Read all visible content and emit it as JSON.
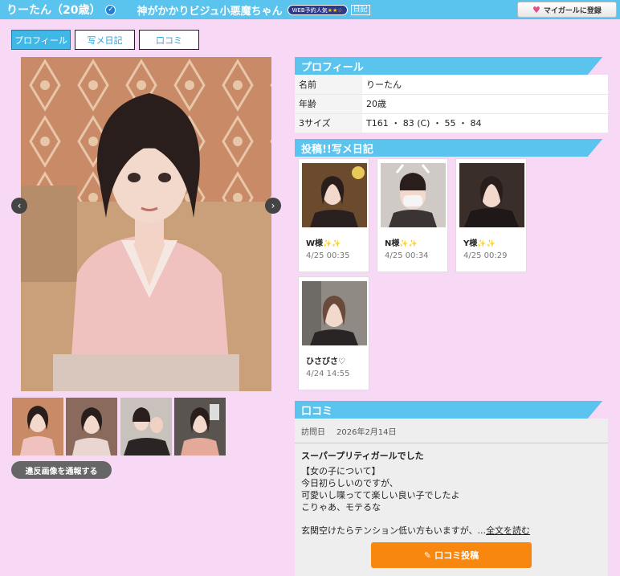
{
  "header": {
    "name": "りーたん（20歳）",
    "shop": "神がかかりビジュ小悪魔ちゃん",
    "web_badge": "WEB予約人気",
    "web_stars": "★★☆",
    "diary_badge": "日記",
    "mygirl_label": "マイガールに登録"
  },
  "tabs": [
    {
      "label": "プロフィール"
    },
    {
      "label": "写メ日記"
    },
    {
      "label": "口コミ"
    }
  ],
  "gallery": {
    "prev_glyph": "‹",
    "next_glyph": "›",
    "report_label": "違反画像を通報する"
  },
  "profile": {
    "heading": "プロフィール",
    "rows": [
      {
        "key": "名前",
        "value": "りーたん"
      },
      {
        "key": "年齢",
        "value": "20歳"
      },
      {
        "key": "3サイズ",
        "value": "T161 ・ 83 (C) ・ 55 ・ 84"
      }
    ]
  },
  "diary": {
    "heading": "投稿!!写メ日記",
    "posts": [
      {
        "name": "W様",
        "date": "4/25 00:35"
      },
      {
        "name": "N様",
        "date": "4/25 00:34"
      },
      {
        "name": "Y様",
        "date": "4/25 00:29"
      },
      {
        "name": "ひさびさ♡",
        "date": "4/24 14:55"
      }
    ],
    "sparkle": "✨✨"
  },
  "review": {
    "heading": "口コミ",
    "visit_label": "訪問日",
    "visit_date": "2026年2月14日",
    "title": "スーパープリティガールでした",
    "line1": "【女の子について】",
    "line2": "今日初らしいのですが、",
    "line3": "可愛いし喋ってて楽しい良い子でしたよ",
    "line4": "こりゃあ、モテるな",
    "excerpt": "玄関空けたらテンション低い方もいますが、...",
    "more_link": "全文を読む",
    "post_button": "口コミ投稿"
  },
  "colors": {
    "accent": "#5bc4ee",
    "background": "#f7d8f5",
    "post_button": "#f7870e"
  }
}
